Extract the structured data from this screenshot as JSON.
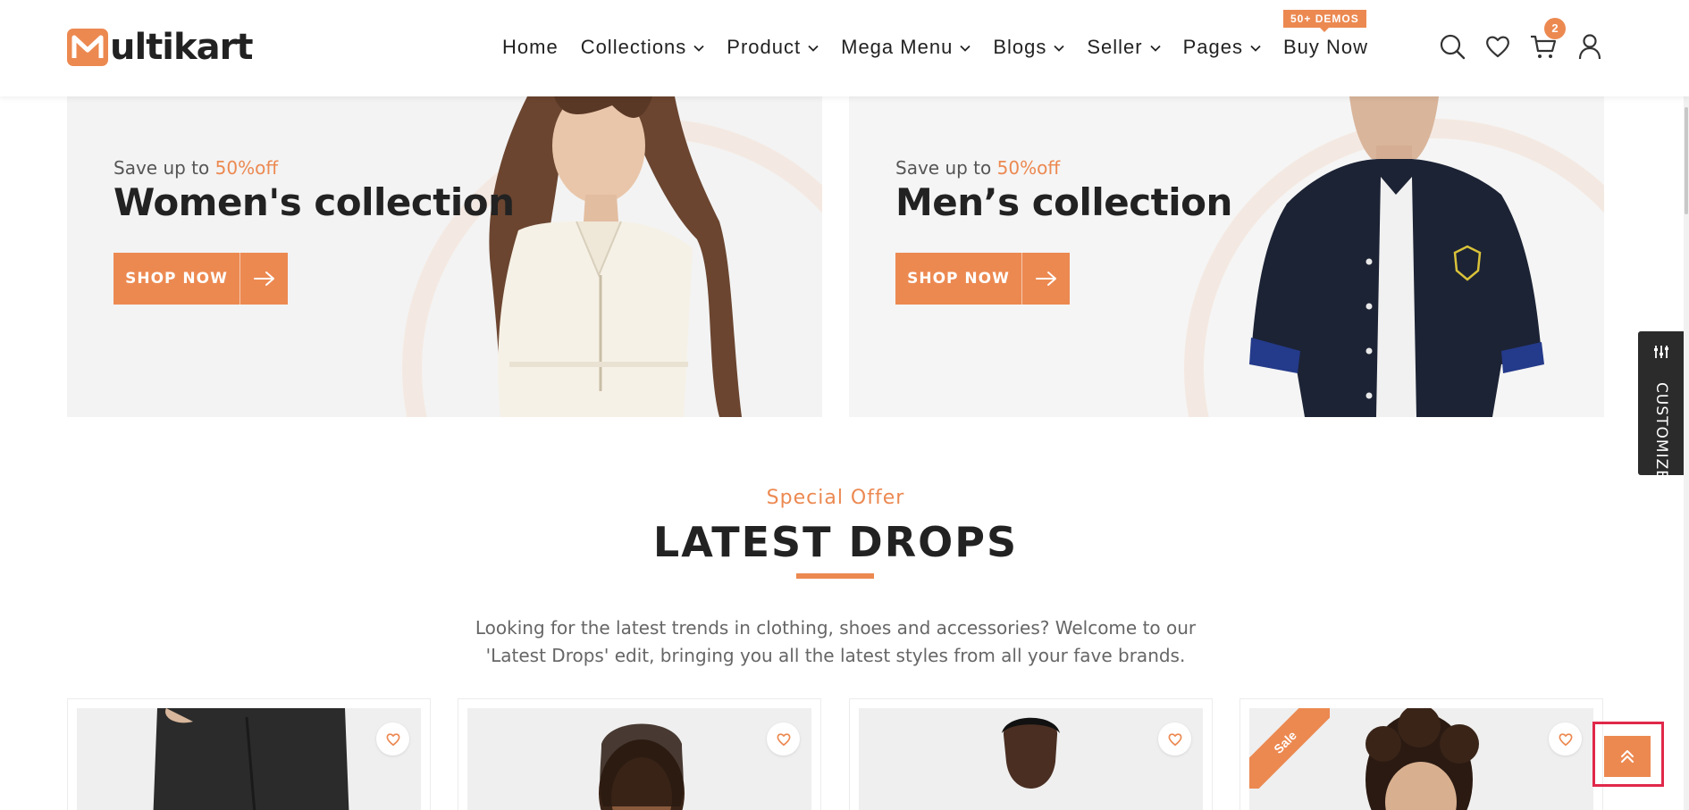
{
  "brand": {
    "logo_letter": "M",
    "logo_text": "ultikart",
    "accent": "#ec8951"
  },
  "nav": {
    "items": [
      {
        "label": "Home",
        "has_dropdown": false
      },
      {
        "label": "Collections",
        "has_dropdown": true
      },
      {
        "label": "Product",
        "has_dropdown": true
      },
      {
        "label": "Mega Menu",
        "has_dropdown": true
      },
      {
        "label": "Blogs",
        "has_dropdown": true
      },
      {
        "label": "Seller",
        "has_dropdown": true
      },
      {
        "label": "Pages",
        "has_dropdown": true
      }
    ],
    "buy_now": "Buy Now",
    "demo_badge": "50+ DEMOS",
    "icons": [
      "search-icon",
      "heart-icon",
      "cart-icon",
      "user-icon"
    ],
    "cart_count": "2"
  },
  "banners": [
    {
      "save_prefix": "Save up to",
      "save_value": "50%off",
      "title": "Women's collection",
      "button": "SHOP NOW"
    },
    {
      "save_prefix": "Save up to",
      "save_value": "50%off",
      "title": "Men’s collection",
      "button": "SHOP NOW"
    }
  ],
  "customize": {
    "label": "CUSTOMIZE",
    "icon": "sliders-icon"
  },
  "section": {
    "eyebrow": "Special Offer",
    "title": "LATEST DROPS",
    "description_line1": "Looking for the latest trends in clothing, shoes and accessories? Welcome to our",
    "description_line2": "'Latest Drops' edit, bringing you all the latest styles from all your fave brands."
  },
  "products": [
    {
      "sale": false
    },
    {
      "sale": false
    },
    {
      "sale": false
    },
    {
      "sale": true,
      "sale_label": "Sale"
    }
  ],
  "back_to_top": {
    "icon": "double-chevron-up-icon"
  }
}
